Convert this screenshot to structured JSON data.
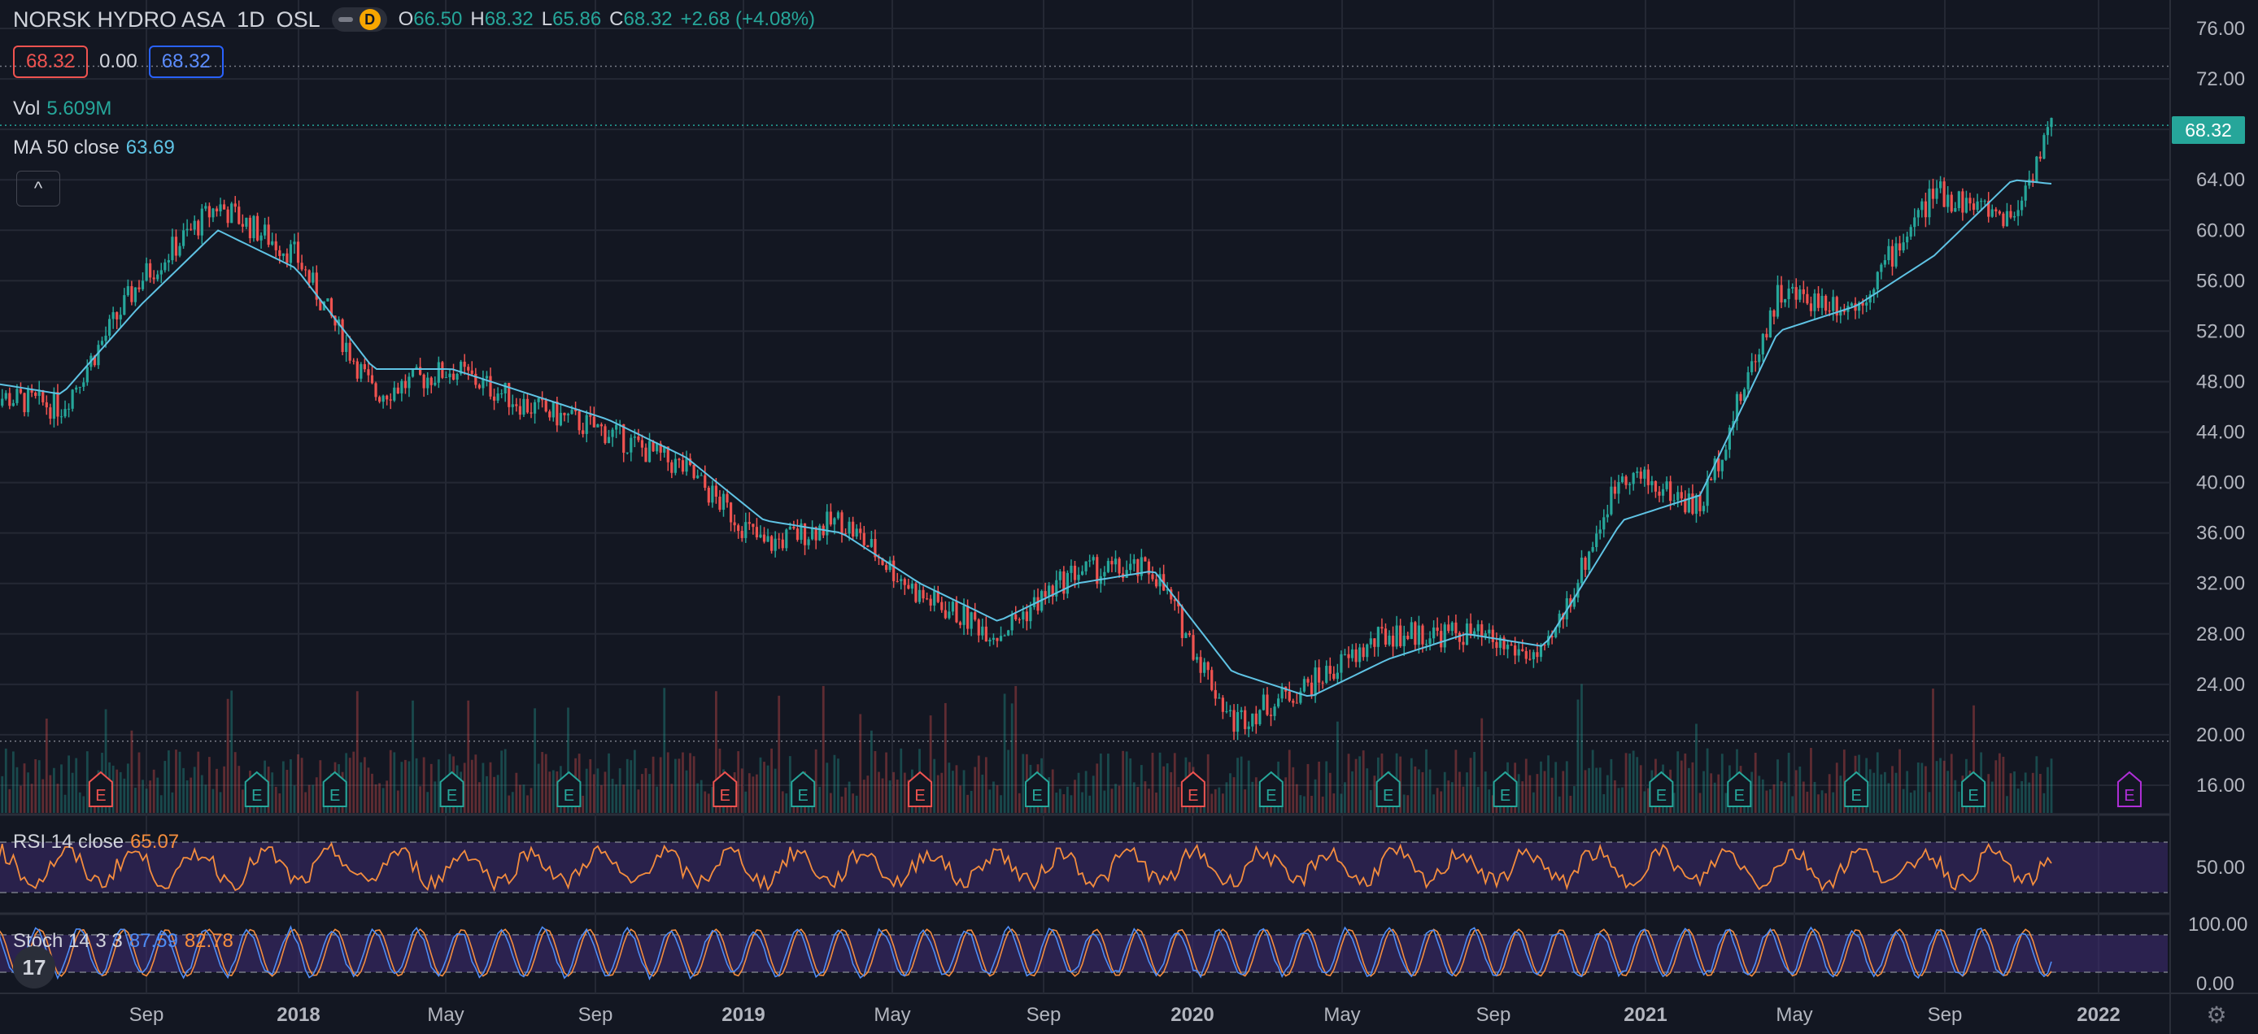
{
  "header": {
    "symbol": "NORSK HYDRO ASA",
    "interval": "1D",
    "exchange": "OSL",
    "badge": "D",
    "ohlc": [
      {
        "key": "O",
        "value": "66.50"
      },
      {
        "key": "H",
        "value": "68.32"
      },
      {
        "key": "L",
        "value": "65.86"
      },
      {
        "key": "C",
        "value": "68.32"
      },
      {
        "key": "",
        "value": "+2.68 (+4.08%)"
      }
    ],
    "bid": "68.32",
    "spread": "0.00",
    "ask": "68.32"
  },
  "indicators": {
    "vol_label": "Vol",
    "vol_value": "5.609M",
    "ma_label": "MA 50 close",
    "ma_value": "63.69",
    "collapse_icon": "^",
    "rsi_label": "RSI 14 close",
    "rsi_value": "65.07",
    "stoch_label": "Stoch 14 3 3",
    "stoch_k": "87.59",
    "stoch_d": "82.78"
  },
  "price_axis": {
    "ticks": [
      "76.00",
      "72.00",
      "68.00",
      "64.00",
      "60.00",
      "56.00",
      "52.00",
      "48.00",
      "44.00",
      "40.00",
      "36.00",
      "32.00",
      "28.00",
      "24.00",
      "20.00",
      "16.00"
    ],
    "last_price": "68.32",
    "rsi_ticks": [
      "50.00"
    ],
    "stoch_ticks": [
      "100.00",
      "0.00"
    ]
  },
  "time_axis": {
    "labels": [
      "Sep",
      "2018",
      "May",
      "Sep",
      "2019",
      "May",
      "Sep",
      "2020",
      "May",
      "Sep",
      "2021",
      "May",
      "Sep",
      "2022"
    ]
  },
  "earnings_markers": {
    "label": "E"
  },
  "colors": {
    "background": "#131722",
    "up": "#26a69a",
    "down": "#ef5350",
    "ma": "#5fc3e4",
    "rsi": "#f48d3e",
    "stoch_k": "#4e8cf5",
    "stoch_d": "#f48d3e",
    "band": "#3c2a6e",
    "earnings_up": "#26a69a",
    "earnings_down": "#ef5350",
    "earnings_future": "#b02fd8"
  },
  "chart_data": {
    "type": "line",
    "title": "NORSK HYDRO ASA · 1D · OSL",
    "ylim": [
      16,
      76
    ],
    "x": [
      "2017-07",
      "2017-09",
      "2017-11",
      "2018-01",
      "2018-03",
      "2018-05",
      "2018-07",
      "2018-09",
      "2018-11",
      "2019-01",
      "2019-03",
      "2019-05",
      "2019-07",
      "2019-09",
      "2019-11",
      "2020-01",
      "2020-03",
      "2020-05",
      "2020-07",
      "2020-09",
      "2020-11",
      "2021-01",
      "2021-03",
      "2021-05",
      "2021-07",
      "2021-09",
      "2021-11",
      "2021-12"
    ],
    "series": [
      {
        "name": "Close",
        "values": [
          47,
          46,
          56,
          62,
          58,
          47,
          49,
          46,
          44,
          41,
          35,
          37,
          31,
          28,
          33,
          33,
          21,
          24,
          28,
          28,
          26,
          41,
          38,
          55,
          54,
          63,
          61,
          68.32
        ]
      },
      {
        "name": "MA 50 close",
        "values": [
          48,
          47,
          54,
          60,
          57,
          49,
          49,
          47,
          45,
          42,
          37,
          36,
          32,
          29,
          32,
          33,
          25,
          23,
          26,
          28,
          27,
          37,
          39,
          52,
          54,
          58,
          64,
          63.69
        ]
      }
    ],
    "earnings": [
      "2017-10",
      "2018-02",
      "2018-04",
      "2018-07",
      "2018-10",
      "2019-02",
      "2019-04",
      "2019-07",
      "2019-10",
      "2020-02",
      "2020-04",
      "2020-07",
      "2020-10",
      "2021-02",
      "2021-04",
      "2021-07",
      "2021-10",
      "2022-02"
    ],
    "rsi": {
      "name": "RSI 14 close",
      "last": 65.07,
      "level": 50
    },
    "stoch": {
      "k": 87.59,
      "d": 82.78
    }
  }
}
